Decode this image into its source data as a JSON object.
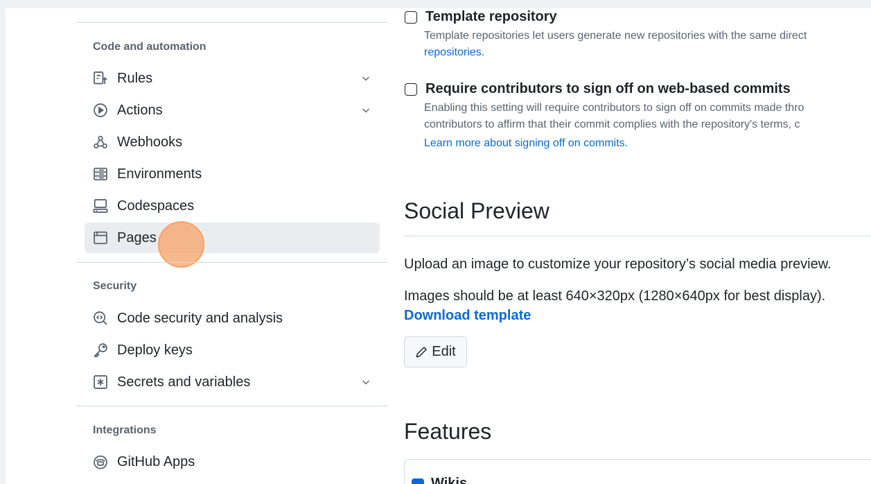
{
  "sidebar": {
    "sections": [
      {
        "heading": "Code and automation",
        "items": [
          {
            "label": "Rules",
            "icon": "rules-icon",
            "has_chevron": true
          },
          {
            "label": "Actions",
            "icon": "play-icon",
            "has_chevron": true
          },
          {
            "label": "Webhooks",
            "icon": "webhook-icon",
            "has_chevron": false
          },
          {
            "label": "Environments",
            "icon": "server-icon",
            "has_chevron": false
          },
          {
            "label": "Codespaces",
            "icon": "codespaces-icon",
            "has_chevron": false
          },
          {
            "label": "Pages",
            "icon": "browser-icon",
            "has_chevron": false,
            "selected": true
          }
        ]
      },
      {
        "heading": "Security",
        "items": [
          {
            "label": "Code security and analysis",
            "icon": "codescan-icon",
            "has_chevron": false
          },
          {
            "label": "Deploy keys",
            "icon": "key-icon",
            "has_chevron": false
          },
          {
            "label": "Secrets and variables",
            "icon": "asterisk-icon",
            "has_chevron": true
          }
        ]
      },
      {
        "heading": "Integrations",
        "items": [
          {
            "label": "GitHub Apps",
            "icon": "copilot-icon",
            "has_chevron": false
          }
        ]
      }
    ]
  },
  "main": {
    "template_repo": {
      "title": "Template repository",
      "desc_line1": "Template repositories let users generate new repositories with the same direct",
      "desc_link": "repositories.",
      "checked": false
    },
    "signoff": {
      "title": "Require contributors to sign off on web-based commits",
      "desc_line1": "Enabling this setting will require contributors to sign off on commits made thro",
      "desc_line2": "contributors to affirm that their commit complies with the repository's terms, c",
      "desc_link": "Learn more about signing off on commits.",
      "checked": false
    },
    "social_preview": {
      "heading": "Social Preview",
      "line1": "Upload an image to customize your repository’s social media preview.",
      "line2": "Images should be at least 640×320px (1280×640px for best display).",
      "download_link": "Download template",
      "edit_label": "Edit"
    },
    "features": {
      "heading": "Features",
      "first_item": "Wikis",
      "first_checked": true
    }
  },
  "colors": {
    "link": "#0969da",
    "muted": "#59636e",
    "selected_bg": "#eaedf0",
    "click_marker": "#f6a261"
  }
}
